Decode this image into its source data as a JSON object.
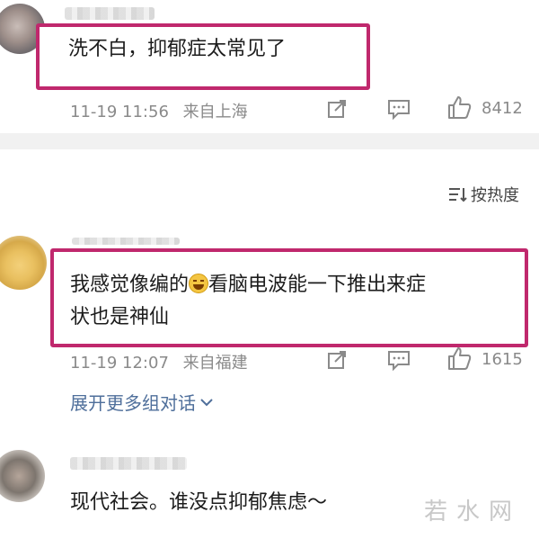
{
  "comments": [
    {
      "text": "洗不白，抑郁症太常见了",
      "time": "11-19 11:56",
      "location": "来自上海",
      "likes": "8412"
    },
    {
      "text_part1": "我感觉像编的",
      "text_part2": "看脑电波能一下推出来症",
      "text_line2": "状也是神仙",
      "emoji": "laughing-crying-emoji",
      "time": "11-19 12:07",
      "location": "来自福建",
      "likes": "1615",
      "expand_label": "展开更多组对话"
    },
    {
      "text": "现代社会。谁没点抑郁焦虑～"
    }
  ],
  "sort": {
    "label": "按热度"
  },
  "watermark": "若水网",
  "colors": {
    "highlight_border": "#c0286d",
    "link": "#4f6f9b",
    "meta": "#8a8a8a"
  }
}
